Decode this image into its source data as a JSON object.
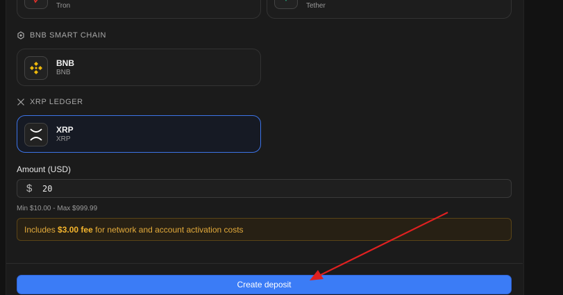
{
  "top_cards": [
    {
      "sub": "Tron",
      "icon": "tron-icon"
    },
    {
      "sub": "Tether",
      "icon": "tether-icon"
    }
  ],
  "sections": [
    {
      "title": "BNB SMART CHAIN",
      "icon": "bnb-chain-icon",
      "card": {
        "name": "BNB",
        "sub": "BNB",
        "icon": "bnb-icon"
      }
    },
    {
      "title": "XRP LEDGER",
      "icon": "xrp-ledger-icon",
      "card": {
        "name": "XRP",
        "sub": "XRP",
        "icon": "xrp-icon",
        "selected": true
      }
    }
  ],
  "amount": {
    "label": "Amount (USD)",
    "currency_symbol": "$",
    "value": "20",
    "hint": "Min $10.00 - Max $999.99"
  },
  "fee_notice": {
    "prefix": "Includes ",
    "fee": "$3.00 fee",
    "suffix": " for network and account activation costs"
  },
  "submit_label": "Create deposit",
  "colors": {
    "accent": "#3b7cf6",
    "selected_border": "#3d74e8",
    "warning_text": "#e3aa3b",
    "annotation_arrow": "#e02020"
  }
}
